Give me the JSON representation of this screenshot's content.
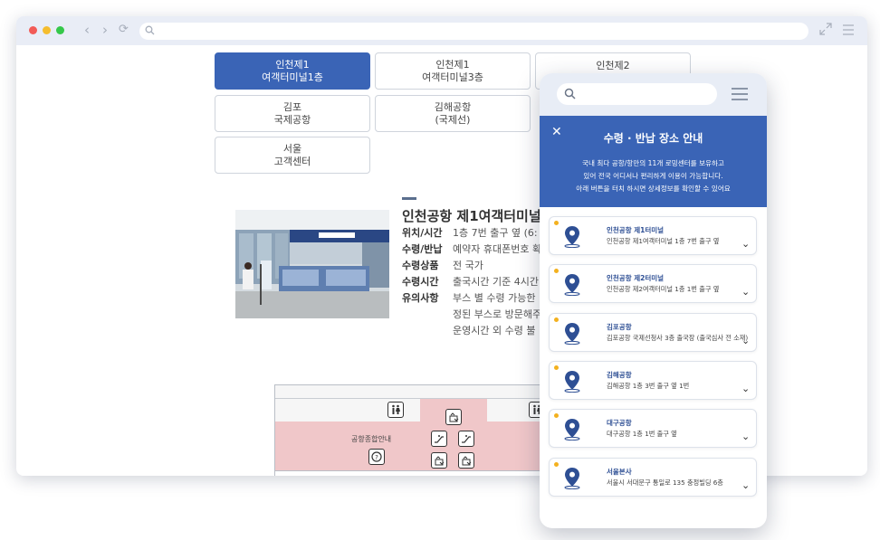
{
  "locations": [
    {
      "line1": "인천제1",
      "line2": "여객터미널1층"
    },
    {
      "line1": "인천제1",
      "line2": "여객터미널3층"
    },
    {
      "line1": "인천제2",
      "line2": ""
    },
    {
      "line1": "김포",
      "line2": "국제공항"
    },
    {
      "line1": "김해공항",
      "line2": "(국제선)"
    },
    {
      "line1": "서울",
      "line2": "고객센터"
    }
  ],
  "detail": {
    "title": "인천공항 제1여객터미널",
    "rows": [
      {
        "key": "위치/시간",
        "value": "1층 7번 출구 옆 (6:"
      },
      {
        "key": "수령/반납",
        "value": "예약자 휴대폰번호 확"
      },
      {
        "key": "수령상품",
        "value": "전 국가"
      },
      {
        "key": "수령시간",
        "value": "출국시간 기준 4시간"
      },
      {
        "key": "유의사항",
        "value": "부스 별 수령 가능한"
      }
    ],
    "notes": [
      "정된 부스로 방문해주",
      "운영시간 외 수령 불"
    ]
  },
  "map": {
    "info_label": "공항종합안내"
  },
  "phone": {
    "banner_title": "수령 · 반납 장소 안내",
    "banner_desc": [
      "국내 최다 공항/항만의 11개 로밍센터를 보유하고",
      "있어 전국 어디서나 편리하게 이용이 가능합니다.",
      "아래 버튼을 터치 하시면 상세정보를 확인할 수 있어요"
    ],
    "close_glyph": "✕",
    "cards": [
      {
        "name": "인천공항 제1터미널",
        "addr": "인천공항 제1여객터미널 1층 7번 출구 옆"
      },
      {
        "name": "인천공항 제2터미널",
        "addr": "인천공항 제2여객터미널 1층 1번 출구 옆"
      },
      {
        "name": "김포공항",
        "addr": "김포공항 국제선청사 3층 출국장 (출국심사 전 소재)"
      },
      {
        "name": "김해공항",
        "addr": "김해공항 1층 3번 출구 옆 1번"
      },
      {
        "name": "대구공항",
        "addr": "대구공항 1층 1번 출구 옆"
      },
      {
        "name": "서울본사",
        "addr": "서울시 서대문구 통일로 135 충정빌딩 6층"
      }
    ]
  },
  "colors": {
    "accent": "#3a64b6",
    "pin": "#2e4f94",
    "star": "#f3b11f",
    "map_highlight": "#f0c7c9"
  }
}
